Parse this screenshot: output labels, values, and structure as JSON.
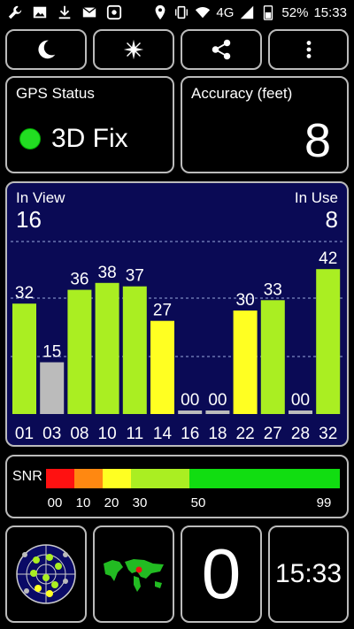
{
  "status_bar": {
    "left_icons": [
      "wrench-icon",
      "image-icon",
      "download-icon",
      "mail-icon",
      "app-icon"
    ],
    "network": "4G",
    "battery": "52%",
    "time": "15:33"
  },
  "toolbar": {
    "buttons": [
      "moon-icon",
      "compass-star-icon",
      "share-icon",
      "more-vertical-icon"
    ]
  },
  "gps_status": {
    "label": "GPS Status",
    "value": "3D Fix",
    "indicator_color": "#22dd22"
  },
  "accuracy": {
    "label": "Accuracy (feet)",
    "value": "8"
  },
  "satellites": {
    "in_view_label": "In View",
    "in_view": "16",
    "in_use_label": "In Use",
    "in_use": "8"
  },
  "chart_data": {
    "type": "bar",
    "categories": [
      "01",
      "03",
      "08",
      "10",
      "11",
      "14",
      "16",
      "18",
      "22",
      "27",
      "28",
      "32"
    ],
    "values": [
      32,
      15,
      36,
      38,
      37,
      27,
      0,
      0,
      30,
      33,
      0,
      42
    ],
    "labels": [
      "32",
      "15",
      "36",
      "38",
      "37",
      "27",
      "00",
      "00",
      "30",
      "33",
      "00",
      "42"
    ],
    "colors": [
      "#aaee22",
      "#bbbbbb",
      "#aaee22",
      "#aaee22",
      "#aaee22",
      "#ffff22",
      "#bbbbbb",
      "#bbbbbb",
      "#ffff22",
      "#aaee22",
      "#bbbbbb",
      "#aaee22"
    ],
    "ylim": [
      0,
      50
    ]
  },
  "snr": {
    "label": "SNR",
    "ticks": [
      "00",
      "10",
      "20",
      "30",
      "50",
      "99"
    ],
    "segments": [
      {
        "color": "#ff1111",
        "from": 0,
        "to": 10
      },
      {
        "color": "#ff8811",
        "from": 10,
        "to": 20
      },
      {
        "color": "#ffff22",
        "from": 20,
        "to": 30
      },
      {
        "color": "#aaee22",
        "from": 30,
        "to": 50
      },
      {
        "color": "#11dd11",
        "from": 50,
        "to": 99
      }
    ]
  },
  "bottom": {
    "count": "0",
    "clock": "15:33"
  }
}
